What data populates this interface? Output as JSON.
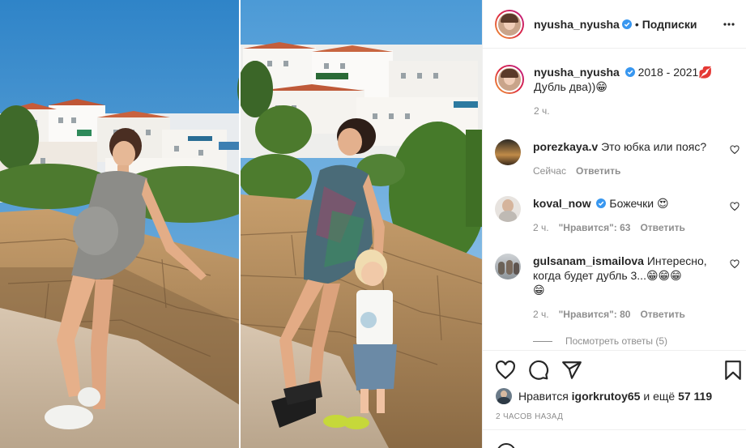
{
  "post": {
    "username": "nyusha_nyusha",
    "separator": "•",
    "follow_label": "Подписки",
    "caption_line1": "2018 - 2021💋",
    "caption_line2": "Дубль два))😁",
    "caption_time": "2 ч."
  },
  "comments": [
    {
      "username": "porezkaya.v",
      "text": "Это юбка или пояс?",
      "time": "Сейчас",
      "reply_label": "Ответить"
    },
    {
      "username": "koval_now",
      "text": "Божечки 😍",
      "time": "2 ч.",
      "likes": "\"Нравится\": 63",
      "reply_label": "Ответить"
    },
    {
      "username": "gulsanam_ismailova",
      "text_line1": "Интересно,",
      "text_line2": "когда будет дубль 3...😁😁😁",
      "text_line3": "😁",
      "time": "2 ч.",
      "likes": "\"Нравится\": 80",
      "reply_label": "Ответить",
      "view_replies": "Посмотреть ответы (5)"
    }
  ],
  "footer": {
    "liked_prefix": "Нравится",
    "liked_user": "igorkrutoy65",
    "liked_and": "и ещё",
    "liked_count": "57 119",
    "posted": "2 ЧАСОВ НАЗАД"
  },
  "icons": {
    "like": "heart-icon",
    "comment": "comment-icon",
    "share": "share-icon",
    "save": "bookmark-icon",
    "verified": "verified-badge-icon"
  },
  "colors": {
    "text": "#262626",
    "secondary": "#8e8e8e",
    "verified": "#3897f0",
    "border": "#efefef"
  }
}
